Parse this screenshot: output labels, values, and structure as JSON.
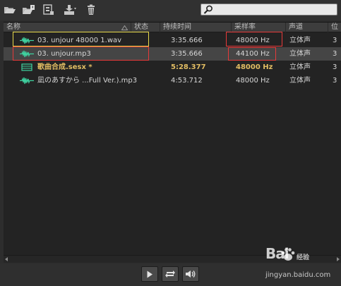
{
  "toolbar": {
    "buttons": [
      "open-file-icon",
      "import-icon",
      "close-file-icon",
      "insert-into-multitrack-icon",
      "delete-icon"
    ]
  },
  "search": {
    "placeholder": "",
    "value": ""
  },
  "columns": [
    "名称",
    "状态",
    "持续时间",
    "采样率",
    "声道",
    "位"
  ],
  "files": [
    {
      "icon": "waveform-icon",
      "name": "03. unjour 48000 1.wav",
      "status": "",
      "duration": "3:35.666",
      "sample_rate": "48000 Hz",
      "channels": "立体声",
      "bit": "3"
    },
    {
      "icon": "waveform-icon",
      "name": "03. unjour.mp3",
      "status": "",
      "duration": "3:35.666",
      "sample_rate": "44100 Hz",
      "channels": "立体声",
      "bit": "3"
    },
    {
      "icon": "multitrack-session-icon",
      "name": "歌曲合成.sesx *",
      "status": "",
      "duration": "5:28.377",
      "sample_rate": "48000 Hz",
      "channels": "立体声",
      "bit": "3"
    },
    {
      "icon": "waveform-icon",
      "name": "凪のあすから ...Full Ver.).mp3",
      "status": "",
      "duration": "4:53.712",
      "sample_rate": "48000 Hz",
      "channels": "立体声",
      "bit": "3"
    }
  ],
  "playback": {
    "buttons": [
      "play-icon",
      "loop-icon",
      "autoplay-icon"
    ]
  },
  "watermark": {
    "brand": "Bai",
    "sub": "经验",
    "url": "jingyan.baidu.com"
  },
  "colors": {
    "highlight_yellow": "#e7d84a",
    "highlight_red": "#e63a3a",
    "session_text": "#e2bd63",
    "waveform_green": "#3fd2a0"
  }
}
